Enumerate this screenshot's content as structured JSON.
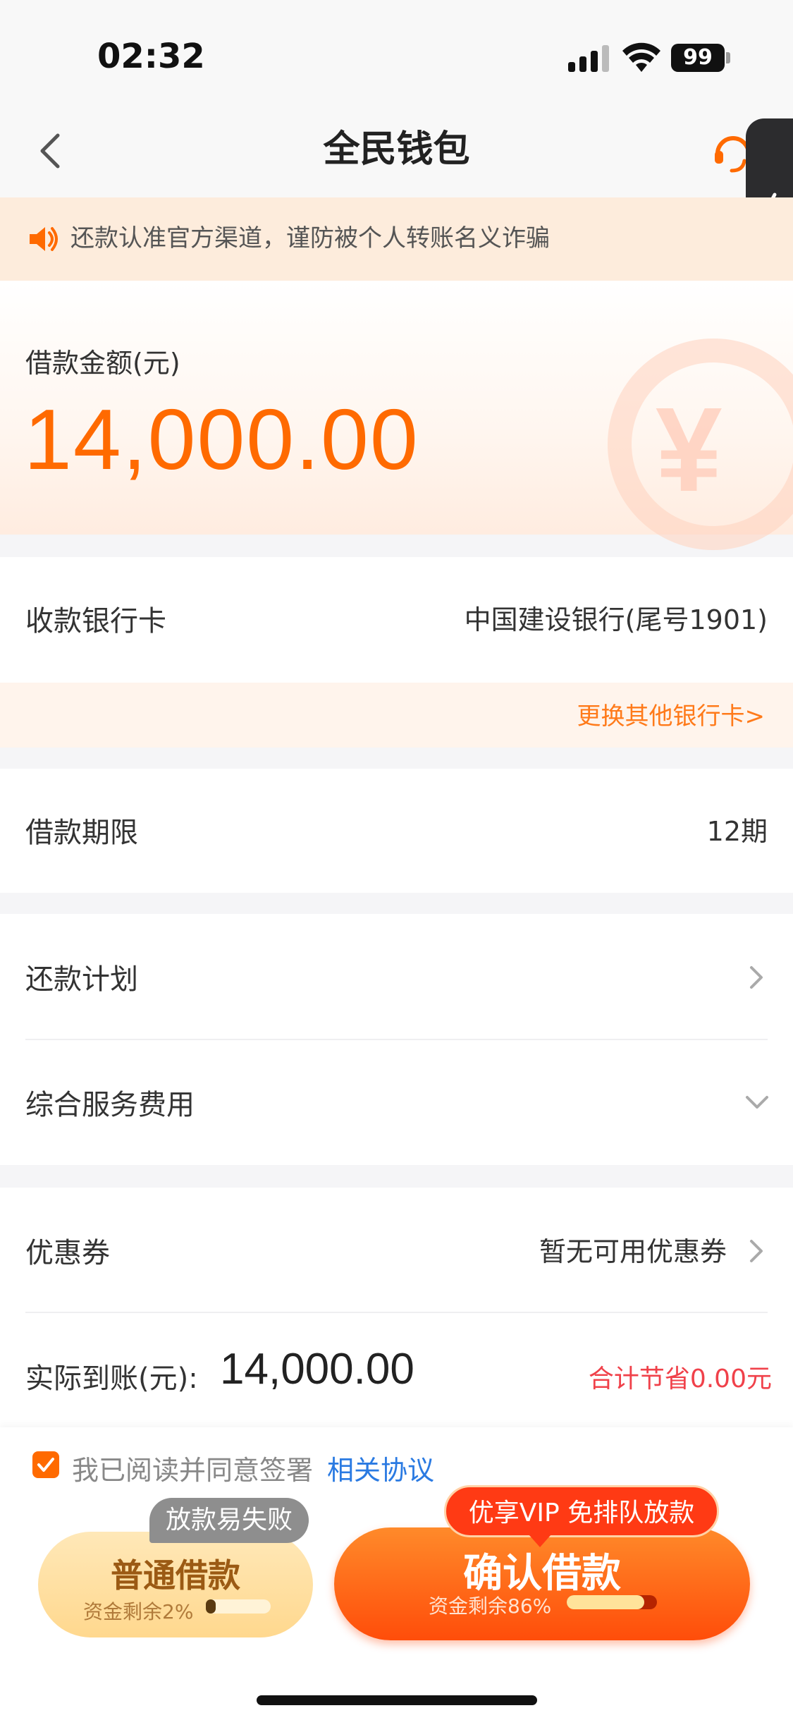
{
  "status_bar": {
    "time": "02:32",
    "battery": "99"
  },
  "nav": {
    "title": "全民钱包"
  },
  "notice": {
    "text": "还款认准官方渠道，谨防被个人转账名义诈骗"
  },
  "amount": {
    "label": "借款金额(元)",
    "value": "14,000.00"
  },
  "bank": {
    "label": "收款银行卡",
    "value": "中国建设银行(尾号1901)",
    "change_link": "更换其他银行卡>"
  },
  "term": {
    "label": "借款期限",
    "value": "12期"
  },
  "plan": {
    "label": "还款计划"
  },
  "fee": {
    "label": "综合服务费用"
  },
  "coupon": {
    "label": "优惠券",
    "value": "暂无可用优惠券"
  },
  "actual": {
    "label": "实际到账(元):",
    "value": "14,000.00",
    "saved": "合计节省0.00元"
  },
  "agreement": {
    "checked": true,
    "text": "我已阅读并同意签署",
    "link": "相关协议"
  },
  "normal_loan": {
    "title": "普通借款",
    "subtitle": "资金剩余2%",
    "remaining_fraction": 0.02,
    "tag": "放款易失败"
  },
  "confirm_loan": {
    "title": "确认借款",
    "subtitle": "资金剩余86%",
    "remaining_fraction": 0.86,
    "tag": "优享VIP 免排队放款"
  },
  "colors": {
    "accent": "#ff6a00",
    "link": "#2a7ae2",
    "saved": "#f0414a"
  }
}
